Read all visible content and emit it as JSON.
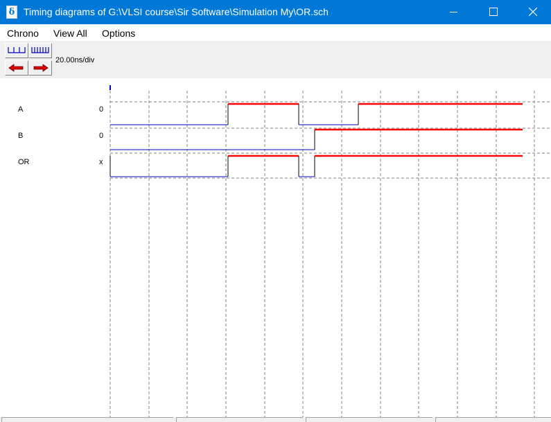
{
  "window": {
    "title": "Timing diagrams of G:\\VLSI course\\Sir Software\\Simulation My\\OR.sch"
  },
  "menu": {
    "chrono": "Chrono",
    "view_all": "View All",
    "options": "Options"
  },
  "toolbar": {
    "scale": "20.00ns/div"
  },
  "signals": [
    {
      "name": "A",
      "value": "0"
    },
    {
      "name": "B",
      "value": "0"
    },
    {
      "name": "OR",
      "value": "x"
    }
  ],
  "colors": {
    "titlebar": "#0078d7",
    "high": "#ff0000",
    "low": "#0000c0",
    "grid": "#808080"
  },
  "icons": [
    "app-icon",
    "zoom-out-icon",
    "zoom-in-icon",
    "scroll-left-icon",
    "scroll-right-icon",
    "minimize-icon",
    "maximize-icon",
    "close-icon"
  ]
}
